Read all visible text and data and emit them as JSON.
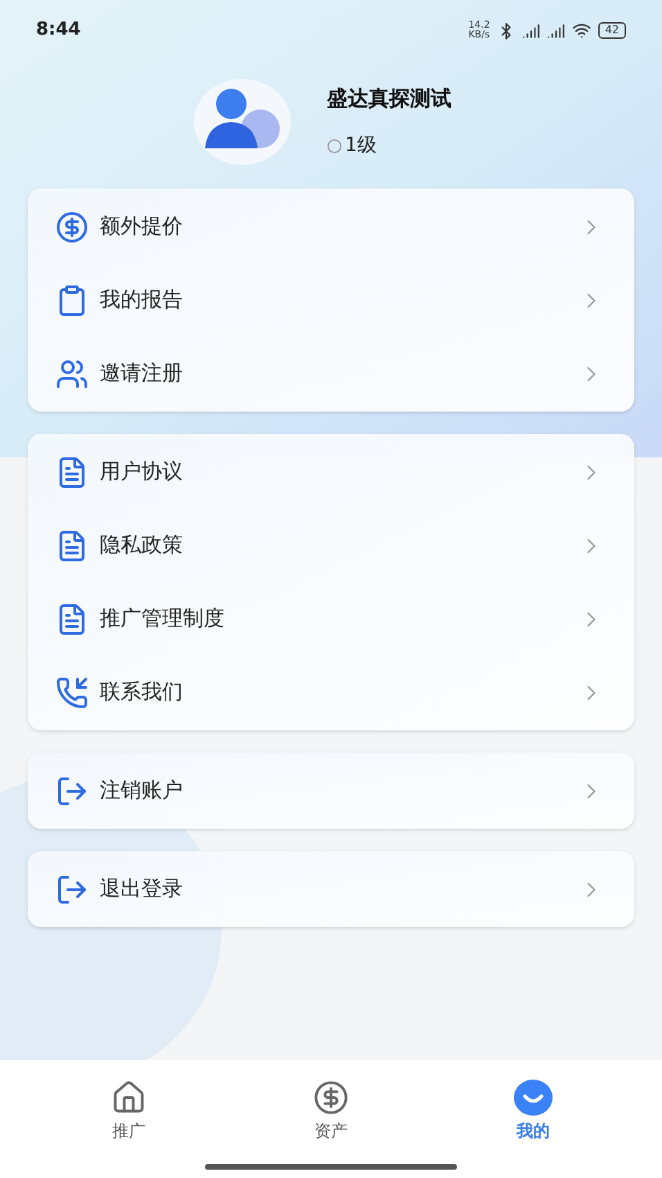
{
  "status_bar": {
    "time": "8:44",
    "speed": "14.2",
    "speed_unit": "KB/s",
    "battery": "42"
  },
  "profile": {
    "name": "盛达真探测试",
    "level": "1级"
  },
  "menu_groups": [
    {
      "items": [
        {
          "label": "额外提价"
        },
        {
          "label": "我的报告"
        },
        {
          "label": "邀请注册"
        }
      ]
    },
    {
      "items": [
        {
          "label": "用户协议"
        },
        {
          "label": "隐私政策"
        },
        {
          "label": "推广管理制度"
        },
        {
          "label": "联系我们"
        }
      ]
    },
    {
      "items": [
        {
          "label": "注销账户"
        }
      ]
    },
    {
      "items": [
        {
          "label": "退出登录"
        }
      ]
    }
  ],
  "tab_bar": [
    {
      "label": "推广",
      "selected": false
    },
    {
      "label": "资产",
      "selected": false
    },
    {
      "label": "我的",
      "selected": true
    }
  ]
}
